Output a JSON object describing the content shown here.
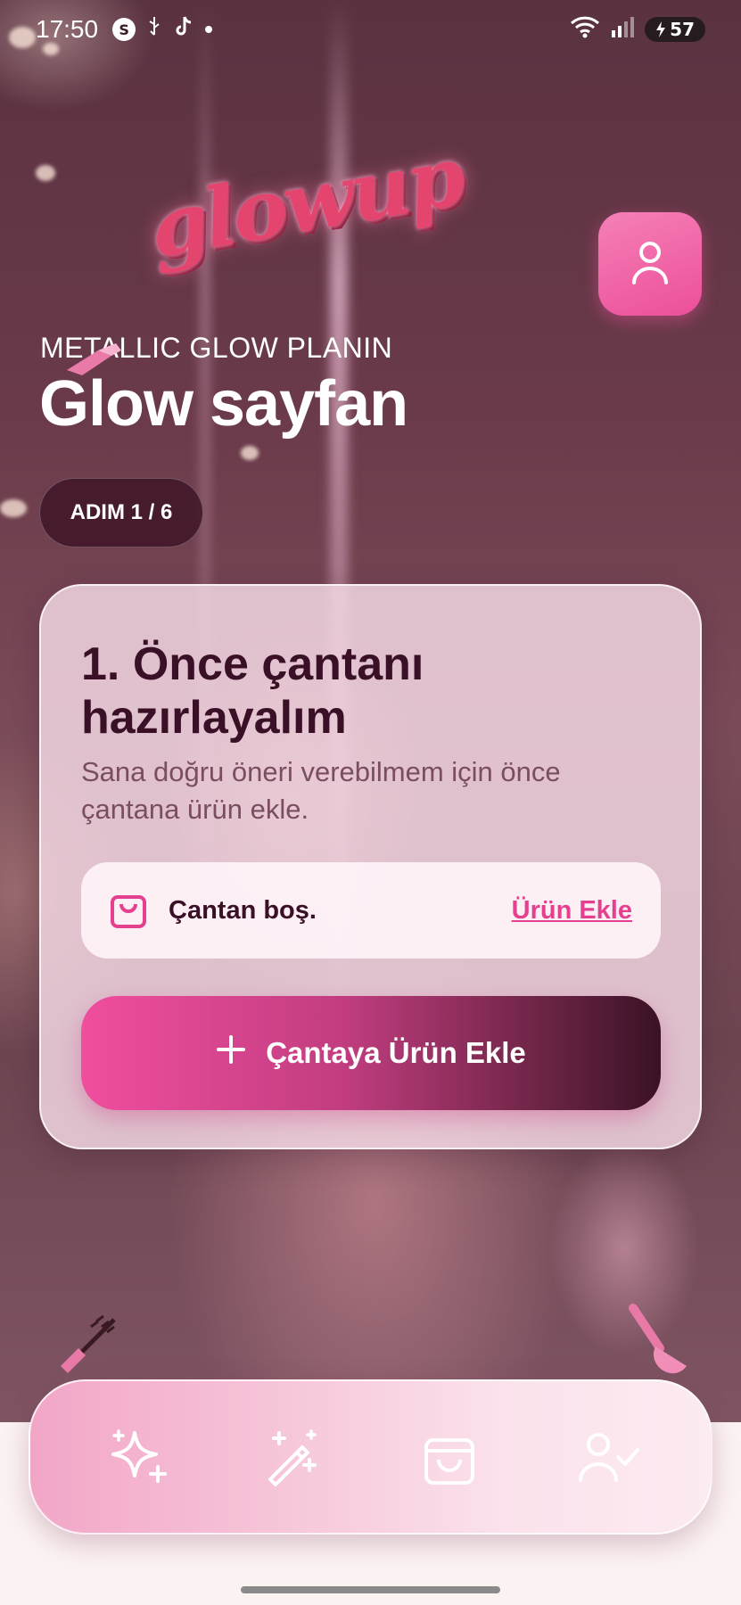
{
  "status_bar": {
    "time": "17:50",
    "notif_badge": "S",
    "battery": "57"
  },
  "header": {
    "logo_text": "glowup",
    "plan_label": "METALLIC GLOW PLANIN",
    "title": "Glow sayfan",
    "step_badge": "ADIM 1 / 6"
  },
  "card": {
    "title": "1. Önce çantanı hazırlayalım",
    "subtitle": "Sana doğru öneri verebilmem için önce çantana ürün ekle.",
    "bag_status": "Çantan boş.",
    "add_link": "Ürün Ekle",
    "add_button": "Çantaya Ürün Ekle"
  },
  "bottom_nav": {
    "items": [
      {
        "icon": "sparkles-icon",
        "active": true
      },
      {
        "icon": "magic-wand-icon",
        "active": false
      },
      {
        "icon": "shopping-bag-icon",
        "active": false
      },
      {
        "icon": "user-check-icon",
        "active": false
      }
    ]
  },
  "colors": {
    "accent_pink": "#ec4f99",
    "dark_plum": "#3a1026",
    "link_pink": "#e4408f"
  }
}
